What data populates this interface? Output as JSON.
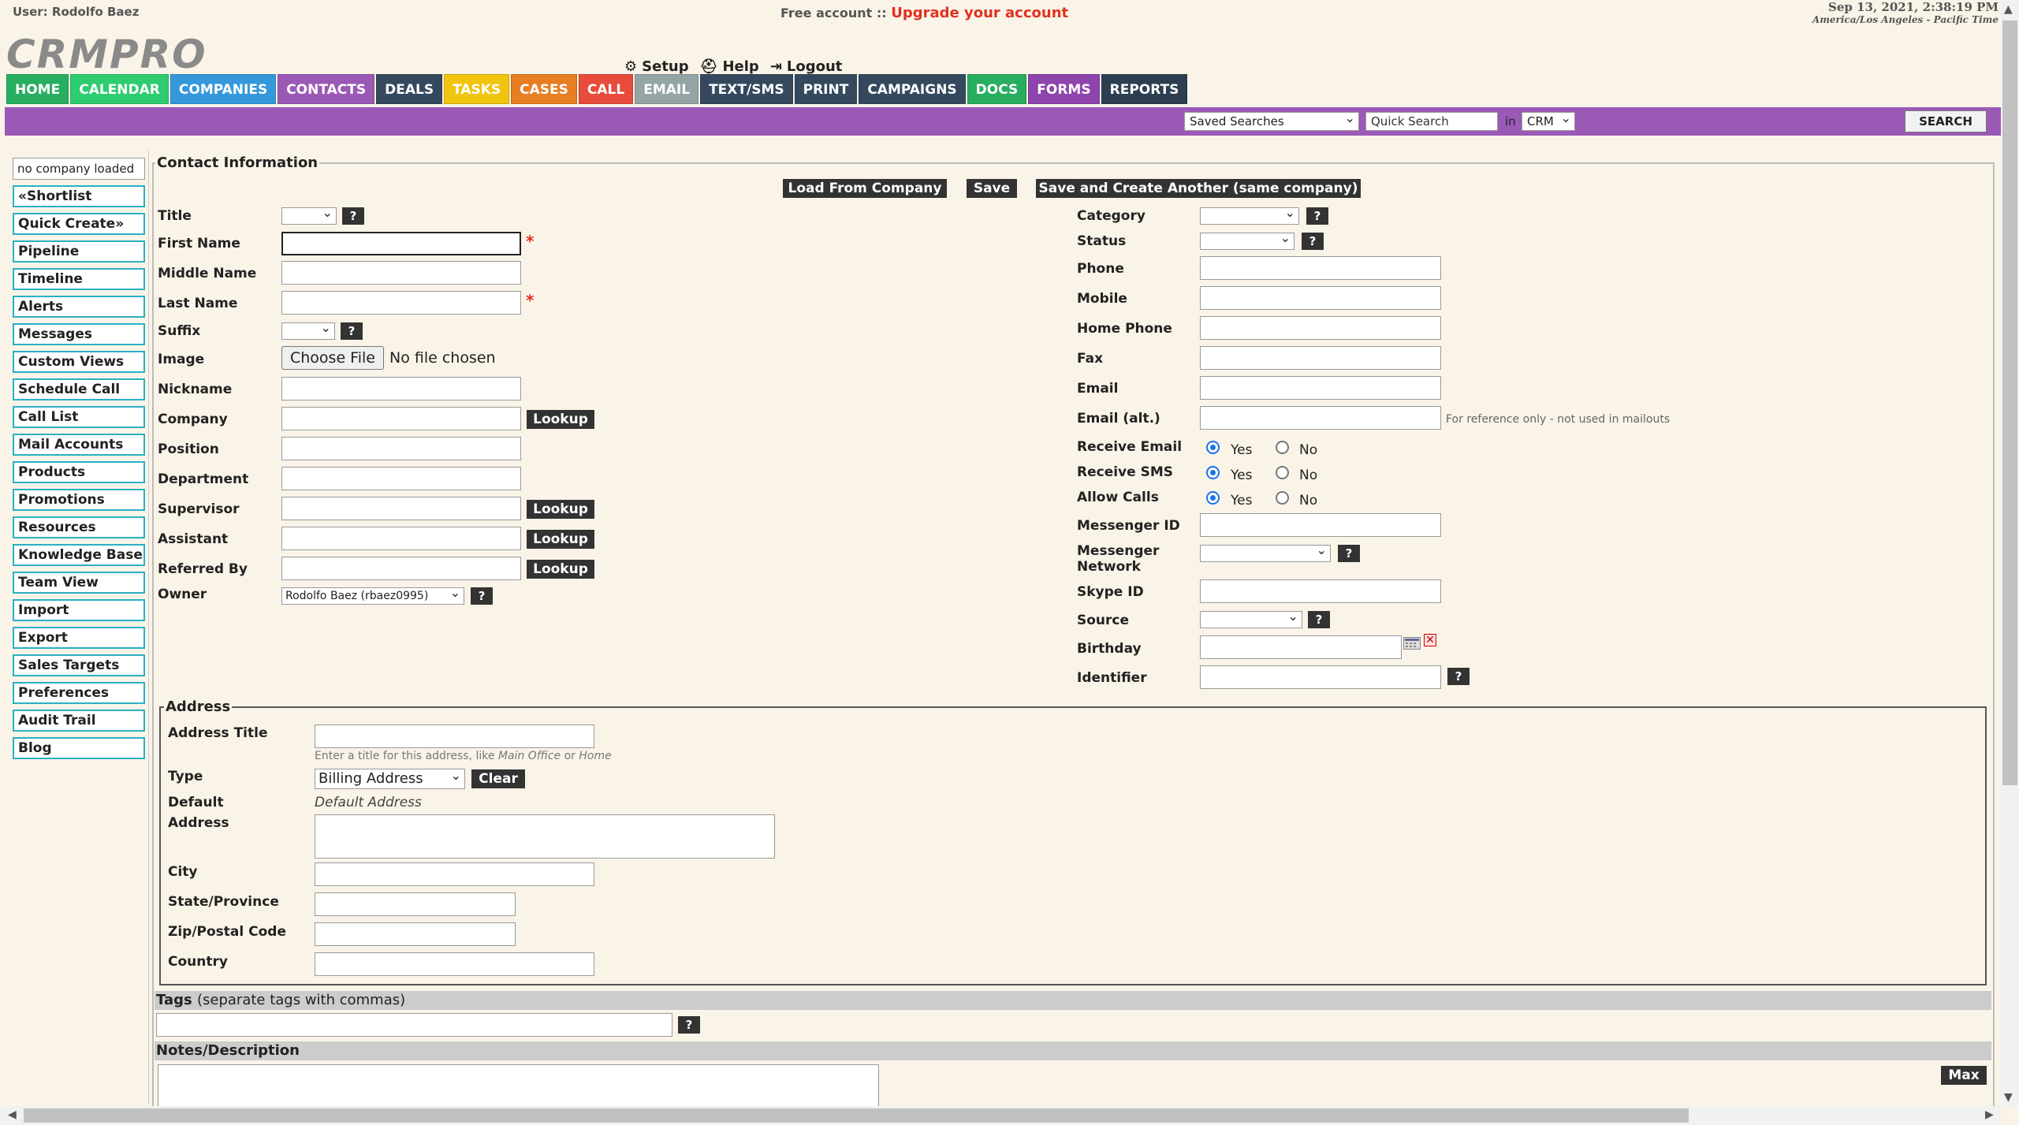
{
  "header": {
    "user": "User: Rodolfo Baez",
    "free_account": "Free account ::",
    "upgrade": "Upgrade your account",
    "date": "Sep 13, 2021, 2:38:19 PM",
    "timezone": "America/Los Angeles - Pacific Time",
    "logo": "CRMPRO",
    "setup": "Setup",
    "help": "Help",
    "logout": "Logout"
  },
  "nav": [
    {
      "label": "HOME",
      "color": "#27ae60"
    },
    {
      "label": "CALENDAR",
      "color": "#2ecc71"
    },
    {
      "label": "COMPANIES",
      "color": "#3498db"
    },
    {
      "label": "CONTACTS",
      "color": "#9b59b6"
    },
    {
      "label": "DEALS",
      "color": "#34495e"
    },
    {
      "label": "TASKS",
      "color": "#f1c40f"
    },
    {
      "label": "CASES",
      "color": "#e67e22"
    },
    {
      "label": "CALL",
      "color": "#e74c3c"
    },
    {
      "label": "EMAIL",
      "color": "#95a5a6"
    },
    {
      "label": "TEXT/SMS",
      "color": "#34495e"
    },
    {
      "label": "PRINT",
      "color": "#34495e"
    },
    {
      "label": "CAMPAIGNS",
      "color": "#34495e"
    },
    {
      "label": "DOCS",
      "color": "#27ae60"
    },
    {
      "label": "FORMS",
      "color": "#8e44ad"
    },
    {
      "label": "REPORTS",
      "color": "#2c3e50"
    }
  ],
  "search": {
    "saved_searches": "Saved Searches",
    "quick_search_placeholder": "Quick Search",
    "in": "in",
    "scope": "CRM",
    "button": "SEARCH"
  },
  "sidebar": {
    "company_status": "no company loaded",
    "items": [
      "«Shortlist",
      "Quick Create»",
      "Pipeline",
      "Timeline",
      "Alerts",
      "Messages",
      "Custom Views",
      "Schedule Call",
      "Call List",
      "Mail Accounts",
      "Products",
      "Promotions",
      "Resources",
      "Knowledge Base",
      "Team View",
      "Import",
      "Export",
      "Sales Targets",
      "Preferences",
      "Audit Trail",
      "Blog"
    ]
  },
  "form": {
    "legend": "Contact Information",
    "load_from_company": "Load From Company",
    "save": "Save",
    "save_and_create": "Save and Create Another (same company)",
    "help": "?",
    "required": "*",
    "lookup": "Lookup",
    "left": {
      "title": "Title",
      "first_name": "First Name",
      "middle_name": "Middle Name",
      "last_name": "Last Name",
      "suffix": "Suffix",
      "image": "Image",
      "choose_file": "Choose File",
      "no_file": "No file chosen",
      "nickname": "Nickname",
      "company": "Company",
      "position": "Position",
      "department": "Department",
      "supervisor": "Supervisor",
      "assistant": "Assistant",
      "referred_by": "Referred By",
      "owner": "Owner",
      "owner_value": "Rodolfo Baez (rbaez0995)"
    },
    "right": {
      "category": "Category",
      "status": "Status",
      "phone": "Phone",
      "mobile": "Mobile",
      "home_phone": "Home Phone",
      "fax": "Fax",
      "email": "Email",
      "email_alt": "Email (alt.)",
      "email_alt_note": "For reference only - not used in mailouts",
      "receive_email": "Receive Email",
      "receive_sms": "Receive SMS",
      "allow_calls": "Allow Calls",
      "yes": "Yes",
      "no": "No",
      "messenger_id": "Messenger ID",
      "messenger_network_1": "Messenger",
      "messenger_network_2": "Network",
      "skype_id": "Skype ID",
      "source": "Source",
      "birthday": "Birthday",
      "identifier": "Identifier"
    }
  },
  "address": {
    "legend": "Address",
    "address_title": "Address Title",
    "title_hint": "Enter a title for this address, like",
    "hint_main": "Main Office",
    "hint_or": "or",
    "hint_home": "Home",
    "type": "Type",
    "type_value": "Billing Address",
    "clear": "Clear",
    "default": "Default",
    "default_value": "Default Address",
    "address": "Address",
    "city": "City",
    "state": "State/Province",
    "zip": "Zip/Postal Code",
    "country": "Country"
  },
  "tags": {
    "label": "Tags",
    "hint": "(separate tags with commas)"
  },
  "notes": {
    "label": "Notes/Description",
    "max": "Max"
  }
}
